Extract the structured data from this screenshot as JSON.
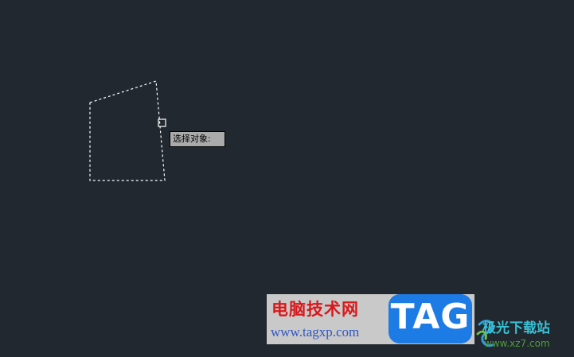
{
  "app": {
    "canvas_background": "#212830"
  },
  "selection": {
    "state": "selection-preview-dashed-quadrilateral",
    "pickbox": "square-cursor"
  },
  "tooltip": {
    "prompt": "选择对象:"
  },
  "watermark": {
    "site_name": "电脑技术网",
    "site_url": "www.tagxp.com",
    "badge_text": "TAG",
    "badge_color": "#1d7be5"
  },
  "watermark2": {
    "brand_name": "极光下载站",
    "brand_url": "www.xz7.com",
    "logo_icon": "aurora-swirl-icon"
  }
}
